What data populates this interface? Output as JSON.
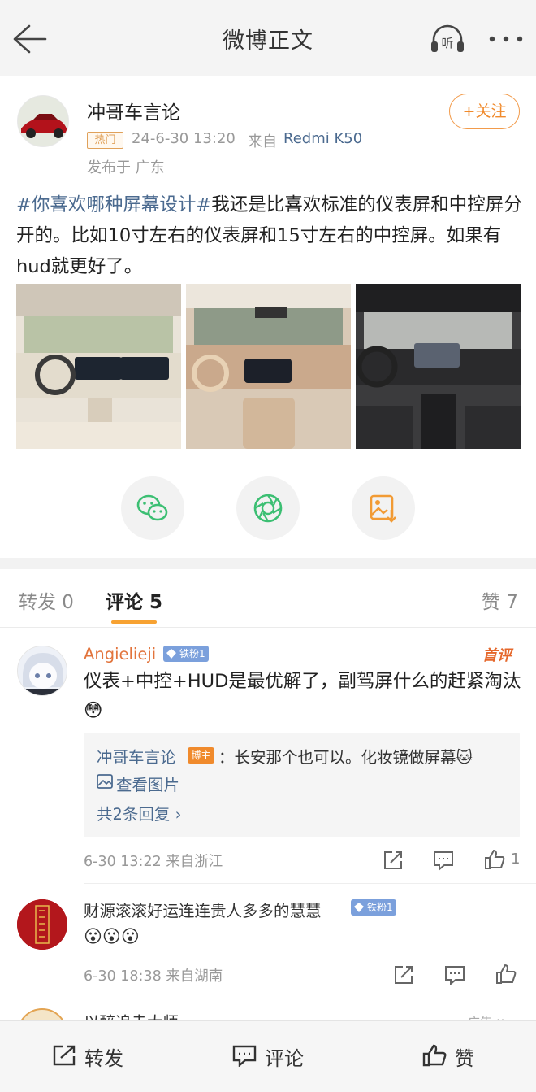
{
  "nav": {
    "title": "微博正文",
    "listen_label": "听"
  },
  "post": {
    "author": "冲哥车言论",
    "hot_badge": "热门",
    "time": "24-6-30 13:20",
    "from_label": "来自",
    "device": "Redmi K50",
    "location": "发布于 广东",
    "follow_label": "+关注",
    "topic": "#你喜欢哪种屏幕设计#",
    "text": "我还是比喜欢标准的仪表屏和中控屏分开的。比如10寸左右的仪表屏和15寸左右的中控屏。如果有hud就更好了。"
  },
  "tabs": {
    "repost": "转发 0",
    "comment": "评论 5",
    "like": "赞 7"
  },
  "comments": [
    {
      "name": "Angielieji",
      "fan_badge": "铁粉1",
      "first_tag": "首评",
      "text": "仪表+中控+HUD是最优解了，副驾屏什么的赶紧淘汰😳",
      "reply": {
        "name": "冲哥车言论",
        "host_badge": "博主",
        "text": "：长安那个也可以。化妆镜做屏幕🐱",
        "view_images": "查看图片",
        "total": "共2条回复 ›"
      },
      "meta": "6-30 13:22  来自浙江",
      "likes": "1"
    },
    {
      "name": "财源滚滚好运连连贵人多多的慧慧",
      "fan_badge": "铁粉1",
      "text": "😮😮😮",
      "meta": "6-30 18:38  来自湖南"
    },
    {
      "name": "以醉追赤大师",
      "ad_label": "广告 ∨"
    }
  ],
  "bottom_bar": {
    "repost": "转发",
    "comment": "评论",
    "like": "赞"
  },
  "colors": {
    "accent_orange": "#f08a2c",
    "link_blue": "#4b6a8f",
    "commenter_orange": "#e2743c"
  }
}
